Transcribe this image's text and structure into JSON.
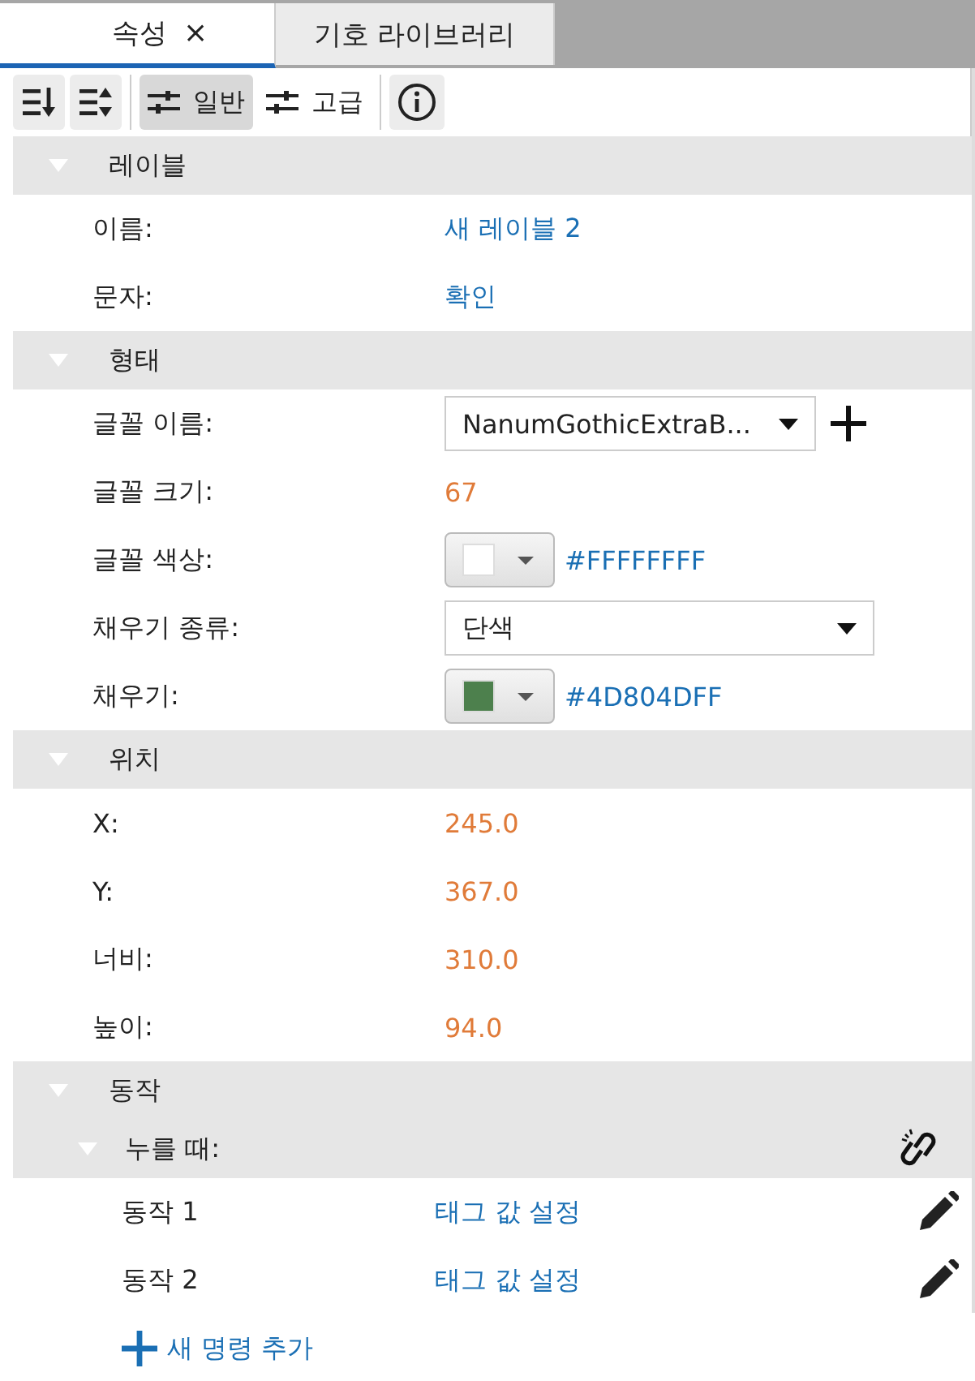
{
  "tabs": [
    {
      "label": "속성",
      "selected": true,
      "close": "×"
    },
    {
      "label": "기호 라이브러리",
      "selected": false
    }
  ],
  "toolbar": [
    {
      "kind": "sort-down",
      "selected": false
    },
    {
      "kind": "sort-up",
      "selected": false
    },
    {
      "kind": "toggle",
      "label": "일반",
      "selected": true
    },
    {
      "kind": "toggle",
      "label": "고급",
      "selected": false
    },
    {
      "kind": "info",
      "selected": false
    }
  ],
  "sections": [
    {
      "title": "레이블",
      "expanded": true,
      "rows": [
        {
          "kind": "text",
          "label": "이름:",
          "value": "새 레이블 2"
        },
        {
          "kind": "text",
          "label": "문자:",
          "value": "확인"
        }
      ]
    },
    {
      "title": "형태",
      "expanded": true,
      "rows": [
        {
          "kind": "dropdown",
          "label": "글꼴 이름:",
          "value": "NanumGothicExtraB...",
          "addable": true
        },
        {
          "kind": "number",
          "label": "글꼴 크기:",
          "value": "67"
        },
        {
          "kind": "color",
          "label": "글꼴 색상:",
          "value": "#FFFFFFFF",
          "color": "#ffffff"
        },
        {
          "kind": "dropdown",
          "label": "채우기 종류:",
          "value": "단색",
          "addable": false
        },
        {
          "kind": "color",
          "label": "채우기:",
          "value": "#4D804DFF",
          "color": "#4d804d"
        }
      ]
    },
    {
      "title": "위치",
      "expanded": true,
      "rows": [
        {
          "kind": "number",
          "label": "X:",
          "value": "245.0"
        },
        {
          "kind": "number",
          "label": "Y:",
          "value": "367.0"
        },
        {
          "kind": "number",
          "label": "너비:",
          "value": "310.0"
        },
        {
          "kind": "number",
          "label": "높이:",
          "value": "94.0"
        }
      ]
    },
    {
      "title": "동작",
      "expanded": true,
      "events": [
        {
          "title": "누를 때:",
          "expanded": true,
          "actions": [
            {
              "label": "동작 1",
              "value": "태그 값 설정"
            },
            {
              "label": "동작 2",
              "value": "태그 값 설정"
            }
          ],
          "add_label": "새 명령 추가"
        }
      ]
    }
  ]
}
